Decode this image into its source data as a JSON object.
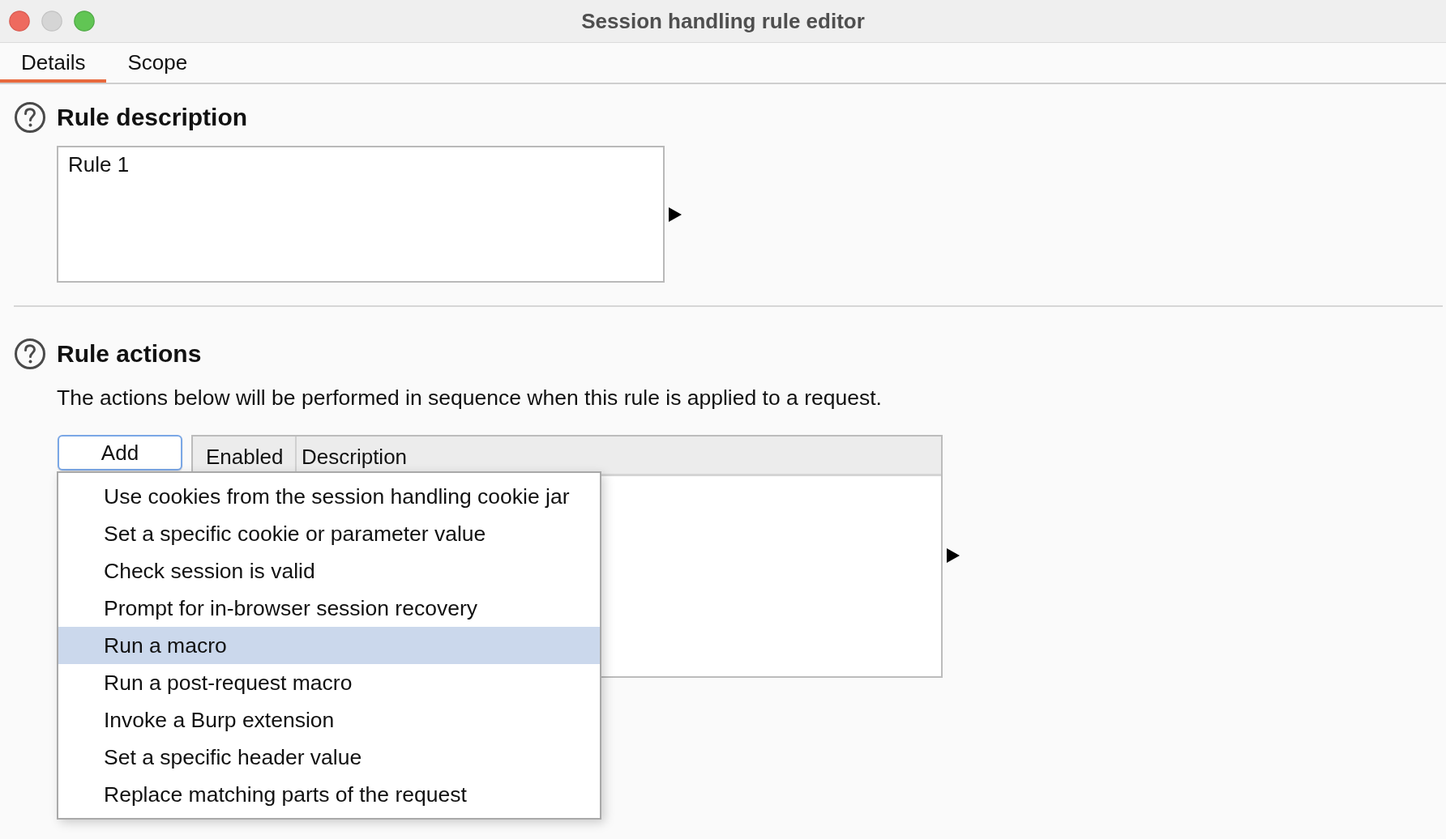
{
  "window": {
    "title": "Session handling rule editor",
    "controls": [
      {
        "kind": "close",
        "disabled": false
      },
      {
        "kind": "minimize",
        "disabled": true
      },
      {
        "kind": "zoom",
        "disabled": false
      }
    ]
  },
  "tabs": [
    {
      "label": "Details",
      "selected": true
    },
    {
      "label": "Scope",
      "selected": false
    }
  ],
  "rule_description": {
    "heading": "Rule description",
    "value": "Rule 1"
  },
  "rule_actions": {
    "heading": "Rule actions",
    "text": "The actions below will be performed in sequence when this rule is applied to a request.",
    "add_button": "Add",
    "table": {
      "columns": [
        "Enabled",
        "Description"
      ]
    }
  },
  "add_menu": {
    "items": [
      {
        "label": "Use cookies from the session handling cookie jar",
        "selected": false
      },
      {
        "label": "Set a specific cookie or parameter value",
        "selected": false
      },
      {
        "label": "Check session is valid",
        "selected": false
      },
      {
        "label": "Prompt for in-browser session recovery",
        "selected": false
      },
      {
        "label": "Run a macro",
        "selected": true
      },
      {
        "label": "Run a post-request macro",
        "selected": false
      },
      {
        "label": "Invoke a Burp extension",
        "selected": false
      },
      {
        "label": "Set a specific header value",
        "selected": false
      },
      {
        "label": "Replace matching parts of the request",
        "selected": false
      }
    ]
  }
}
